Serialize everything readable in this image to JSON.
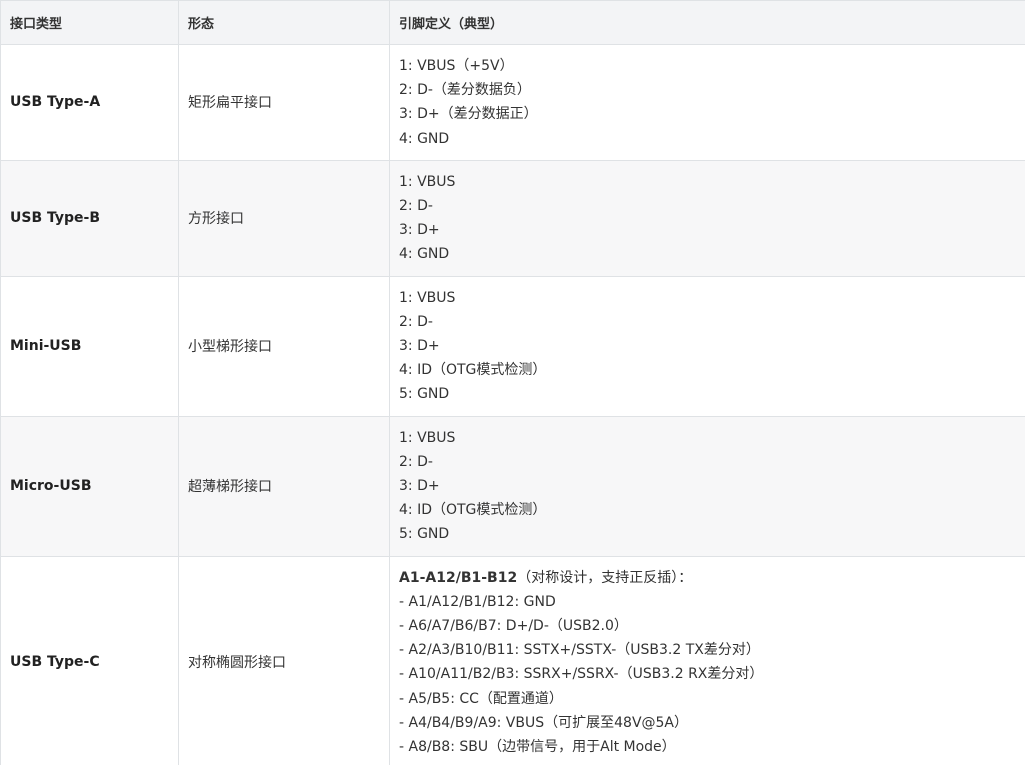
{
  "table": {
    "headers": [
      "接口类型",
      "形态",
      "引脚定义（典型）"
    ],
    "rows": [
      {
        "name": "USB Type-A",
        "shape": "矩形扁平接口",
        "pins": [
          "1: VBUS（+5V）",
          "2: D-（差分数据负）",
          "3: D+（差分数据正）",
          "4: GND"
        ]
      },
      {
        "name": "USB Type-B",
        "shape": "方形接口",
        "pins": [
          "1: VBUS",
          "2: D-",
          "3: D+",
          "4: GND"
        ]
      },
      {
        "name": "Mini-USB",
        "shape": "小型梯形接口",
        "pins": [
          "1: VBUS",
          "2: D-",
          "3: D+",
          "4: ID（OTG模式检测）",
          "5: GND"
        ]
      },
      {
        "name": "Micro-USB",
        "shape": "超薄梯形接口",
        "pins": [
          "1: VBUS",
          "2: D-",
          "3: D+",
          "4: ID（OTG模式检测）",
          "5: GND"
        ]
      },
      {
        "name": "USB Type-C",
        "shape": "对称椭圆形接口",
        "pins_intro_bold": "A1-A12/B1-B12",
        "pins_intro_rest": "（对称设计，支持正反插）：",
        "pins": [
          "- A1/A12/B1/B12: GND",
          "- A6/A7/B6/B7: D+/D-（USB2.0）",
          "- A2/A3/B10/B11: SSTX+/SSTX-（USB3.2 TX差分对）",
          "- A10/A11/B2/B3: SSRX+/SSRX-（USB3.2 RX差分对）",
          "- A5/B5: CC（配置通道）",
          "- A4/B4/B9/A9: VBUS（可扩展至48V@5A）",
          "- A8/B8: SBU（边带信号，用于Alt Mode）"
        ]
      }
    ]
  }
}
